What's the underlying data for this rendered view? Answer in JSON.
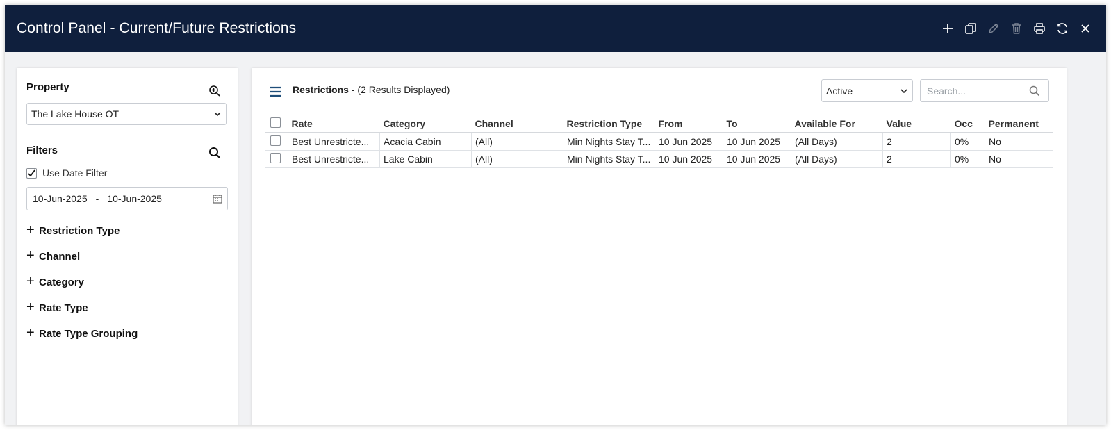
{
  "window": {
    "title": "Control Panel - Current/Future Restrictions",
    "toolbar": [
      {
        "name": "add-icon",
        "enabled": true
      },
      {
        "name": "copy-icon",
        "enabled": true
      },
      {
        "name": "edit-icon",
        "enabled": false
      },
      {
        "name": "delete-icon",
        "enabled": false
      },
      {
        "name": "print-icon",
        "enabled": true
      },
      {
        "name": "refresh-icon",
        "enabled": true
      },
      {
        "name": "close-icon",
        "enabled": true
      }
    ]
  },
  "sidebar": {
    "property_label": "Property",
    "property_value": "The Lake House OT",
    "filters_label": "Filters",
    "use_date_filter_label": "Use Date Filter",
    "use_date_filter_checked": true,
    "date_from": "10-Jun-2025",
    "date_separator": "-",
    "date_to": "10-Jun-2025",
    "expanders": [
      "Restriction Type",
      "Channel",
      "Category",
      "Rate Type",
      "Rate Type Grouping"
    ]
  },
  "main": {
    "heading": "Restrictions",
    "results_text": " - (2 Results Displayed)",
    "status_value": "Active",
    "search_placeholder": "Search...",
    "columns": [
      "Rate",
      "Category",
      "Channel",
      "Restriction Type",
      "From",
      "To",
      "Available For",
      "Value",
      "Occ",
      "Permanent"
    ],
    "rows": [
      [
        "Best Unrestricte...",
        "Acacia Cabin",
        "(All)",
        "Min Nights Stay T...",
        "10 Jun 2025",
        "10 Jun 2025",
        "(All Days)",
        "2",
        "0%",
        "No"
      ],
      [
        "Best Unrestricte...",
        "Lake Cabin",
        "(All)",
        "Min Nights Stay T...",
        "10 Jun 2025",
        "10 Jun 2025",
        "(All Days)",
        "2",
        "0%",
        "No"
      ]
    ]
  },
  "colors": {
    "titlebar": "#0f1f3d",
    "accent": "#1f4e79"
  }
}
